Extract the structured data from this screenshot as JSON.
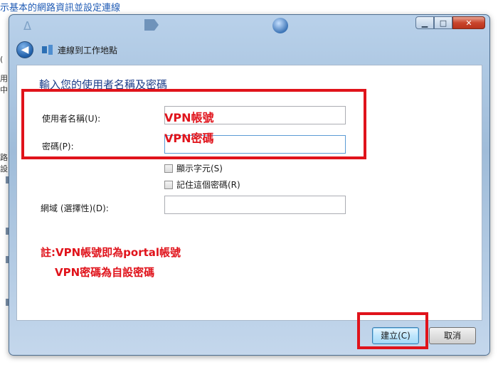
{
  "background": {
    "top_text": "示基本的網路資訊並設定連線",
    "side_labels": [
      "(",
      "用中",
      "路設"
    ]
  },
  "window": {
    "nav_title": "連線到工作地點",
    "controls": {
      "minimize": "▁",
      "maximize": "□",
      "close": "✕"
    }
  },
  "form": {
    "heading": "輸入您的使用者名稱及密碼",
    "username_label": "使用者名稱(U):",
    "username_value": "",
    "password_label": "密碼(P):",
    "password_value": "",
    "show_chars_label": "顯示字元(S)",
    "remember_label": "記住這個密碼(R)",
    "domain_label": "網域 (選擇性)(D):",
    "domain_value": ""
  },
  "annotations": {
    "username_note": "VPN帳號",
    "password_note": "VPN密碼",
    "remark_line1": "註:VPN帳號即為portal帳號",
    "remark_line2": "VPN密碼為自設密碼",
    "highlight_color": "#e0131b"
  },
  "buttons": {
    "connect": "建立(C)",
    "cancel": "取消"
  }
}
